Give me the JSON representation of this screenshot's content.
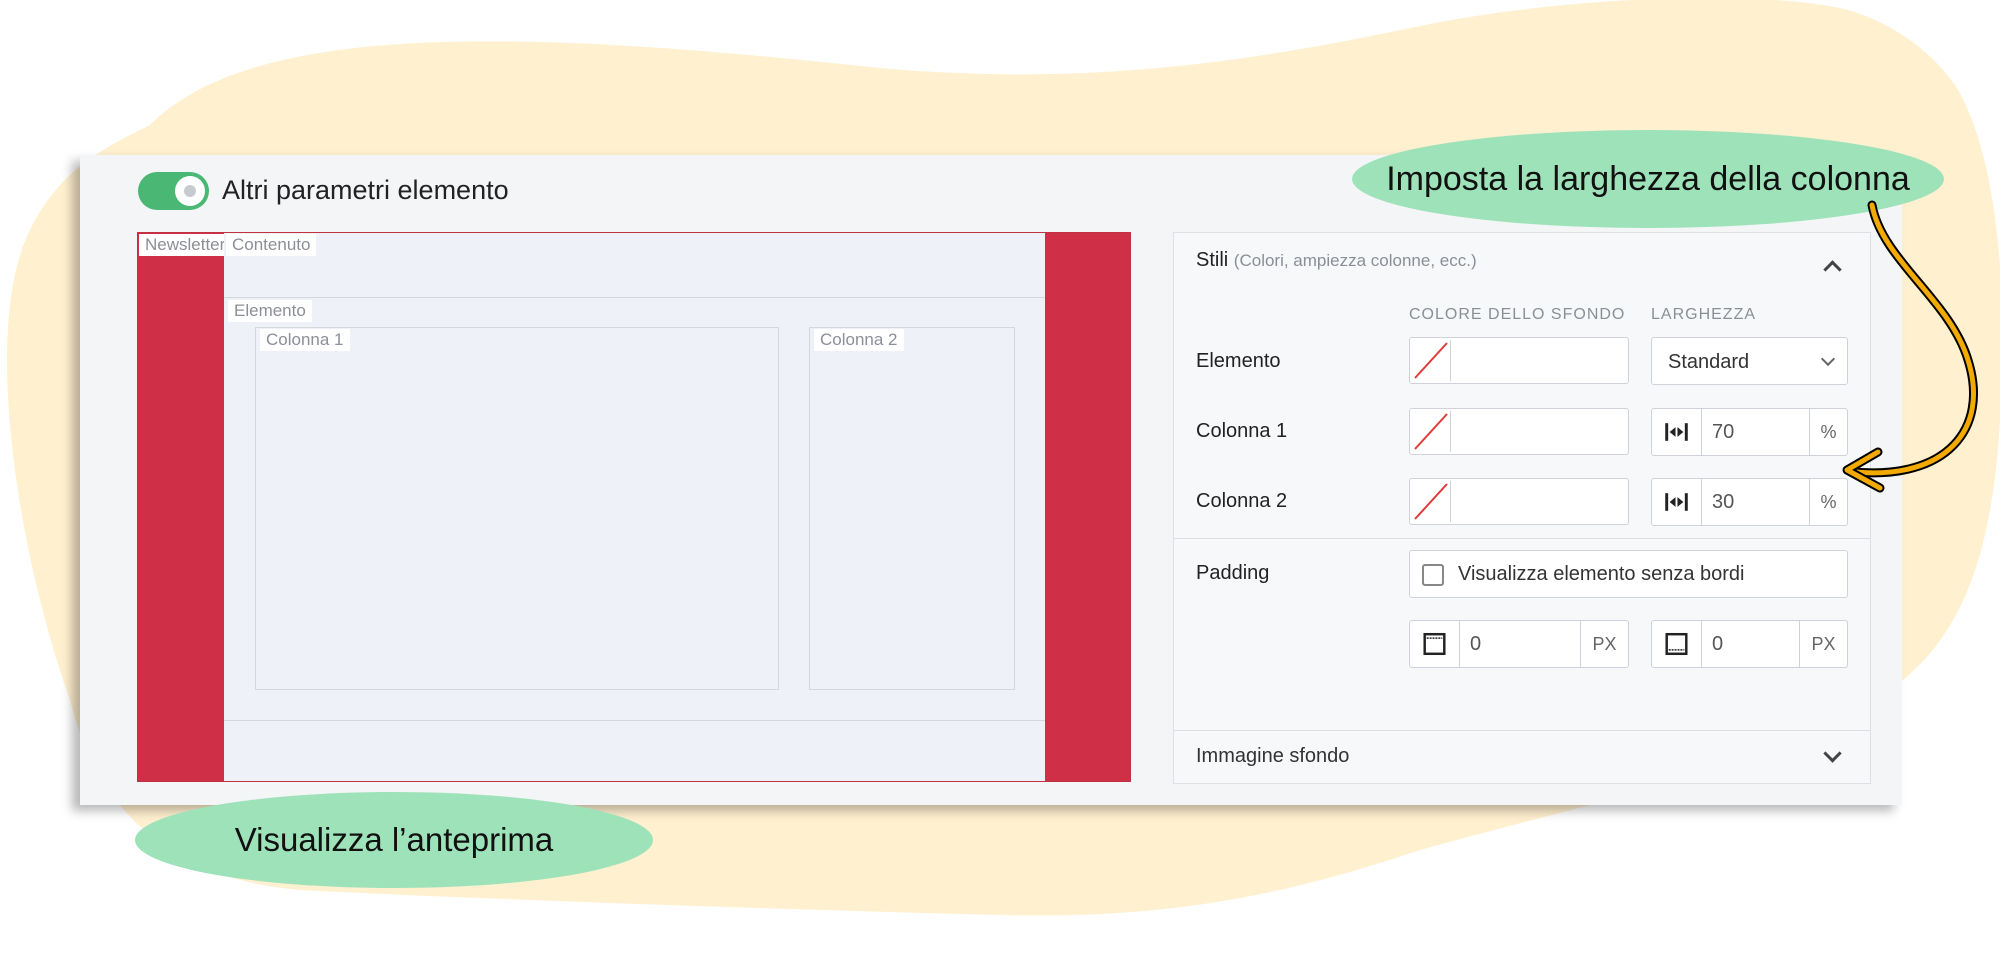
{
  "toggle": {
    "label": "Altri parametri elemento",
    "enabled": true
  },
  "preview": {
    "tags": {
      "newsletter": "Newsletter",
      "contenuto": "Contenuto",
      "elemento": "Elemento",
      "colonna1": "Colonna 1",
      "colonna2": "Colonna 2"
    }
  },
  "styles_panel": {
    "title": "Stili",
    "subtitle": "(Colori, ampiezza colonne, ecc.)",
    "headers": {
      "background": "COLORE DELLO SFONDO",
      "width": "LARGHEZZA"
    },
    "rows": [
      {
        "label": "Elemento",
        "width_select": "Standard"
      },
      {
        "label": "Colonna 1",
        "width_value": "70",
        "width_unit": "%"
      },
      {
        "label": "Colonna 2",
        "width_value": "30",
        "width_unit": "%"
      }
    ],
    "padding": {
      "label": "Padding",
      "checkbox_label": "Visualizza elemento senza bordi",
      "checked": false,
      "top_value": "0",
      "top_unit": "PX",
      "bottom_value": "0",
      "bottom_unit": "PX"
    },
    "background_image": {
      "title": "Immagine sfondo"
    }
  },
  "callouts": {
    "column_width": "Imposta la larghezza della colonna",
    "preview": "Visualizza l’anteprima"
  },
  "colors": {
    "accent_red": "#cf2f47",
    "toggle_green": "#4bb775",
    "callout_green": "#9ee2ba",
    "blob_cream": "#fff0cf",
    "arrow_orange": "#f2aa00"
  }
}
